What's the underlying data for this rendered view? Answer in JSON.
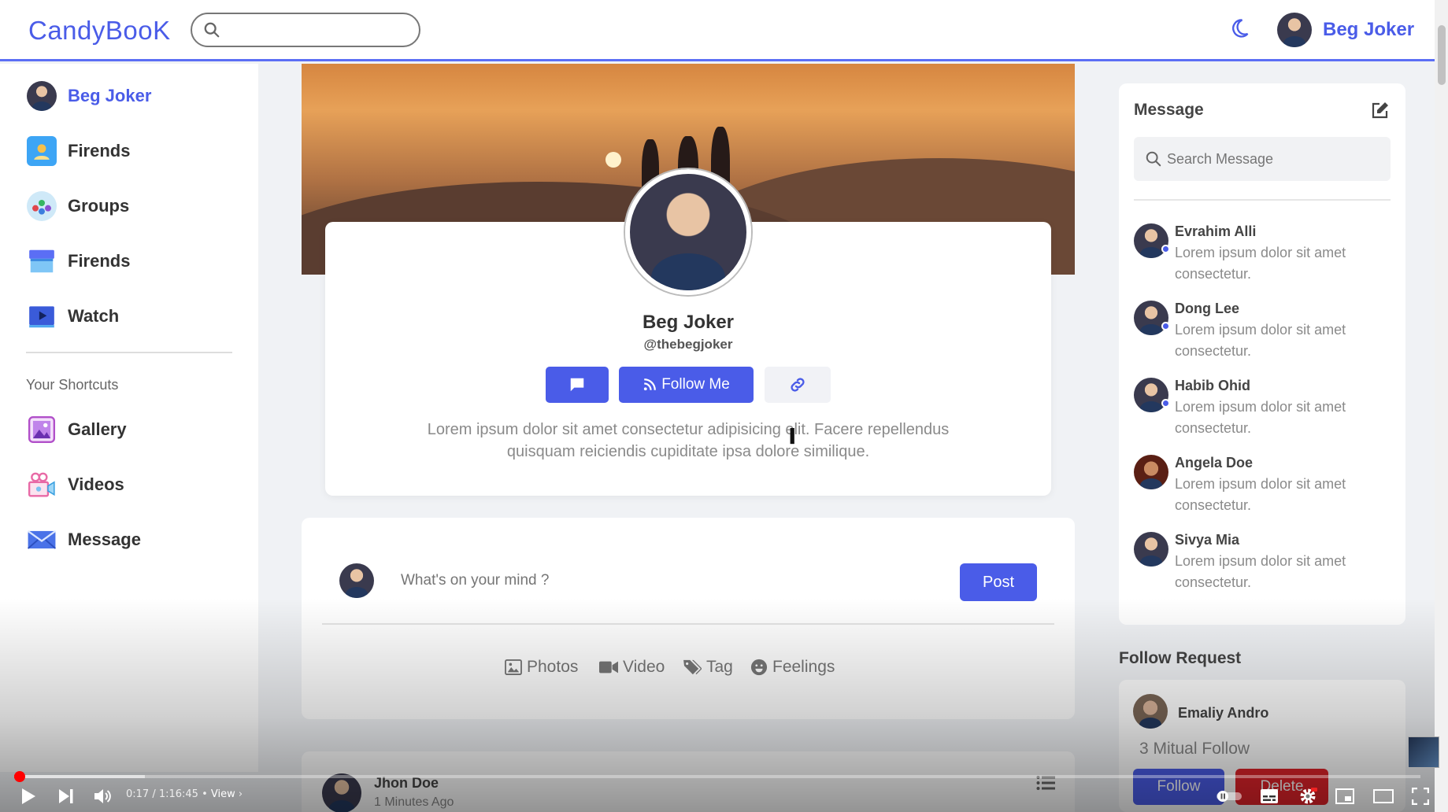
{
  "app": {
    "brand": "CandyBooK"
  },
  "header": {
    "search_placeholder": "",
    "user_name": "Beg Joker"
  },
  "sidebar": {
    "items": [
      {
        "label": "Beg Joker",
        "icon": "user-avatar"
      },
      {
        "label": "Firends",
        "icon": "friends-icon"
      },
      {
        "label": "Groups",
        "icon": "groups-icon"
      },
      {
        "label": "Firends",
        "icon": "marketplace-icon"
      },
      {
        "label": "Watch",
        "icon": "watch-icon"
      }
    ],
    "shortcuts_title": "Your Shortcuts",
    "shortcuts": [
      {
        "label": "Gallery",
        "icon": "gallery-icon"
      },
      {
        "label": "Videos",
        "icon": "videos-icon"
      },
      {
        "label": "Message",
        "icon": "message-icon"
      }
    ]
  },
  "profile": {
    "name": "Beg Joker",
    "handle": "@thebegjoker",
    "follow_label": "Follow Me",
    "bio": "Lorem ipsum dolor sit amet consectetur adipisicing elit. Facere repellendus quisquam reiciendis cupiditate ipsa dolore similique."
  },
  "composer": {
    "placeholder": "What's on your mind ?",
    "post_label": "Post",
    "actions": [
      "Photos",
      "Video",
      "Tag",
      "Feelings"
    ]
  },
  "post": {
    "author": "Jhon Doe",
    "time": "1 Minutes Ago"
  },
  "messages": {
    "title": "Message",
    "search_placeholder": "Search Message",
    "items": [
      {
        "name": "Evrahim Alli",
        "text": "Lorem ipsum dolor sit amet consectetur."
      },
      {
        "name": "Dong Lee",
        "text": "Lorem ipsum dolor sit amet consectetur."
      },
      {
        "name": "Habib Ohid",
        "text": "Lorem ipsum dolor sit amet consectetur."
      },
      {
        "name": "Angela Doe",
        "text": "Lorem ipsum dolor sit amet consectetur."
      },
      {
        "name": "Sivya Mia",
        "text": "Lorem ipsum dolor sit amet consectetur."
      }
    ]
  },
  "follow_request": {
    "title": "Follow Request",
    "name": "Emaliy Andro",
    "mutual": "3 Mitual Follow",
    "follow_label": "Follow",
    "delete_label": "Delete"
  },
  "player": {
    "time": "0:17 / 1:16:45",
    "chapter": "View",
    "progress": 0.0037,
    "buffered": 0.093
  },
  "colors": {
    "accent": "#4a5ce8",
    "danger": "#e2232a",
    "progress": "#ff0000"
  }
}
